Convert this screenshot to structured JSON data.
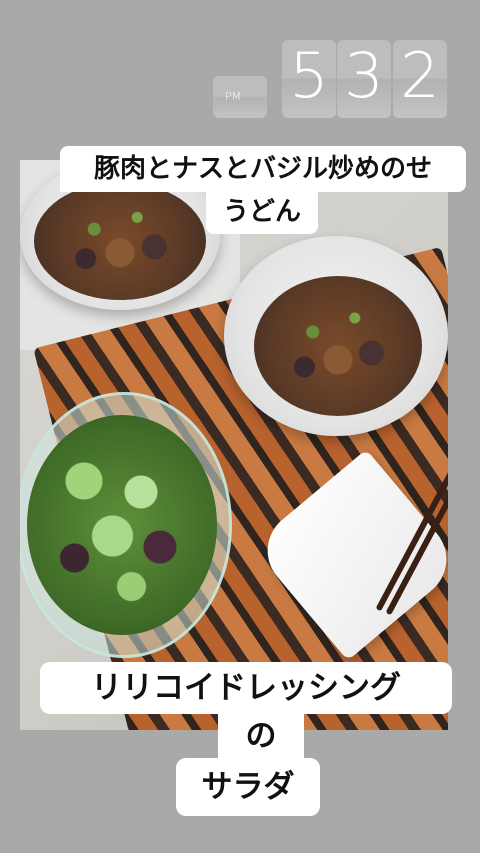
{
  "clock": {
    "ampm": "PM",
    "digit1": "5",
    "digit2": "3",
    "digit3": "2"
  },
  "captions": {
    "dish_line1": "豚肉とナスとバジル炒めのせ",
    "dish_line2": "うどん",
    "salad_line1": "リリコイドレッシング",
    "salad_line2": "の",
    "salad_line3": "サラダ"
  },
  "colors": {
    "background": "#a9a9a7",
    "sticker_bg": "#ffffff",
    "sticker_text": "#111111"
  }
}
